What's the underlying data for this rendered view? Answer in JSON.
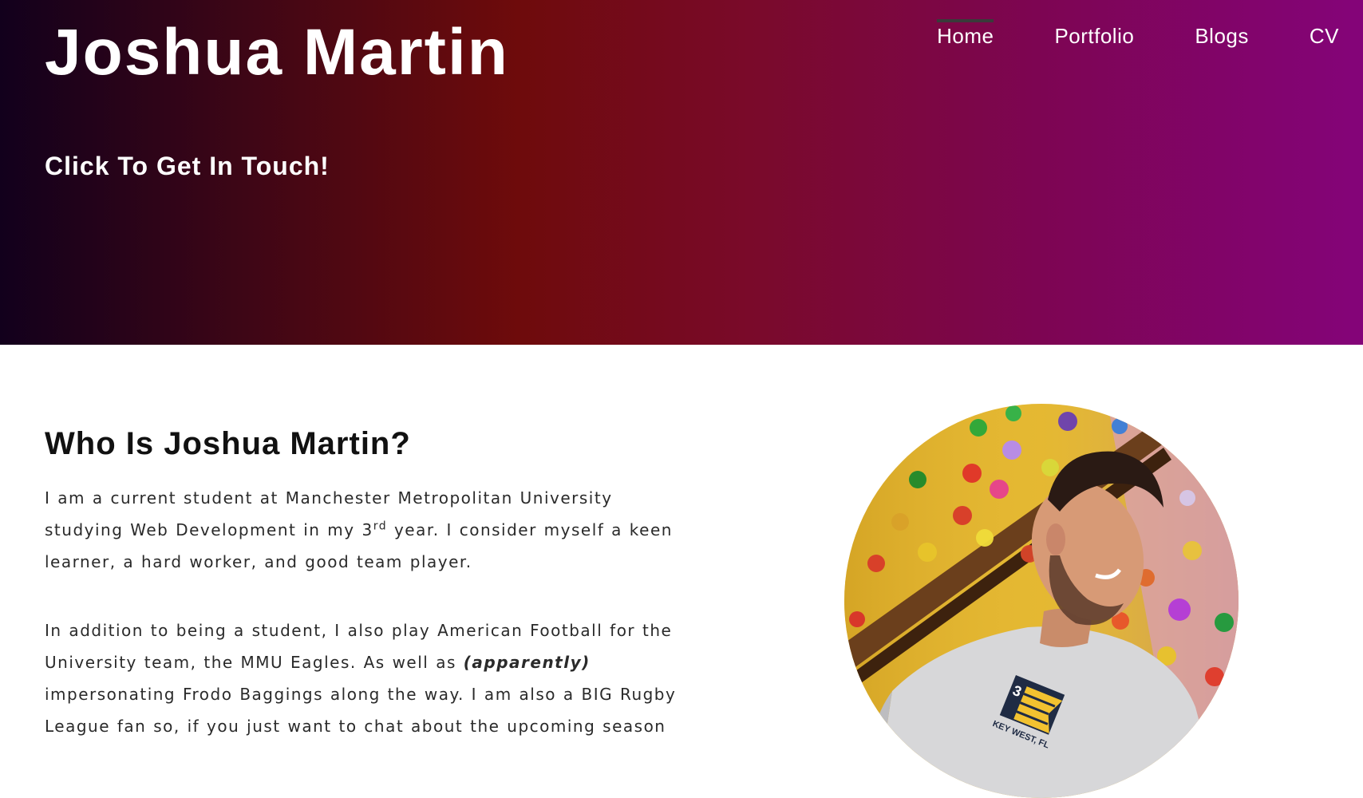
{
  "header": {
    "site_title": "Joshua Martin",
    "cta_link": "Click To Get In Touch!",
    "nav": [
      {
        "label": "Home",
        "active": true
      },
      {
        "label": "Portfolio",
        "active": false
      },
      {
        "label": "Blogs",
        "active": false
      },
      {
        "label": "CV",
        "active": false
      }
    ]
  },
  "about": {
    "heading": "Who Is Joshua Martin?",
    "para1_a": "I am a current student at Manchester Metropolitan University studying Web Development in my 3",
    "para1_sup": "rd",
    "para1_b": " year. I consider myself a keen learner, a hard worker, and good team player.",
    "para2_a": "In addition to being a student, I also play American Football for the University team, the MMU Eagles. As well as ",
    "para2_em": "(apparently)",
    "para2_b": " impersonating Frodo Baggings along the way. I am also a BIG Rugby League fan so, if you just want to chat about the upcoming season",
    "photo_shirt_text": "KEY WEST, FL",
    "photo_shirt_number": "3"
  },
  "colors": {
    "gradient": [
      "#12001c",
      "#6e0b0b",
      "#840479"
    ],
    "nav_active_bar": "#3a3a3a",
    "heading": "#111111",
    "body_text": "#2a2a2a"
  }
}
